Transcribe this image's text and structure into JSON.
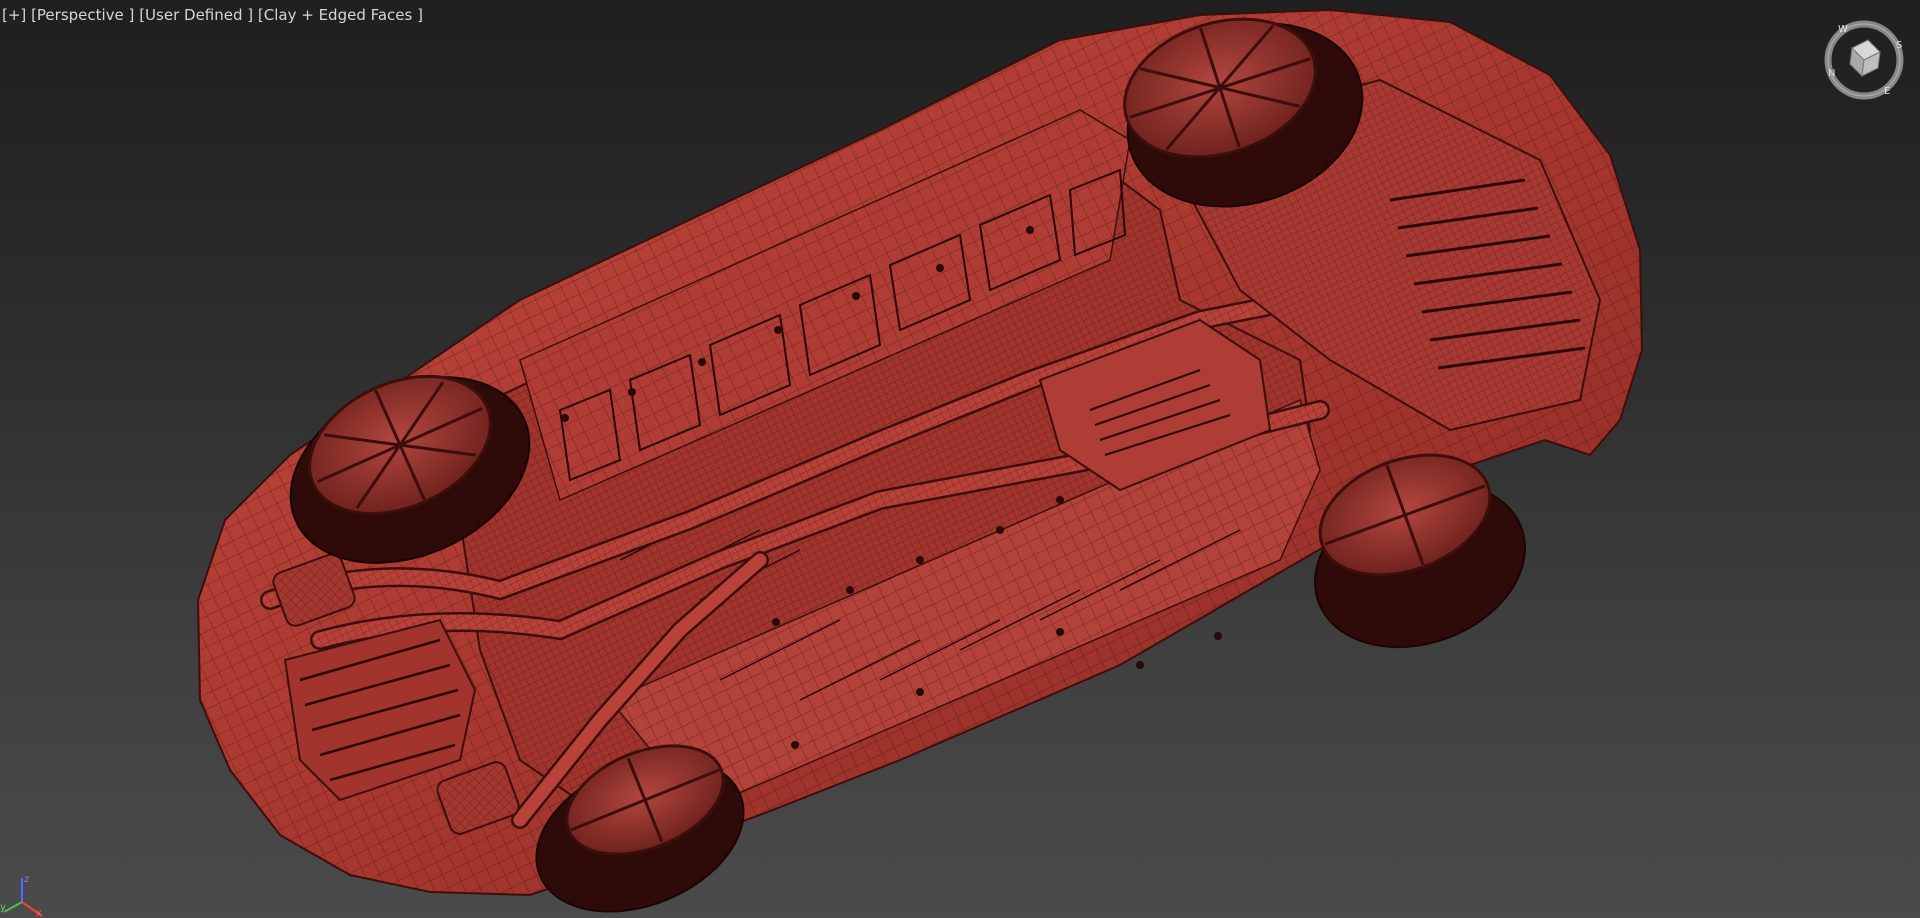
{
  "viewport": {
    "label_parts": [
      "[+]",
      "[Perspective ]",
      "[User Defined ]",
      "[Clay + Edged Faces ]"
    ]
  },
  "viewcube": {
    "compass_letters": [
      "W",
      "S",
      "E",
      "N"
    ]
  },
  "axis_tripod": {
    "x_label": "x",
    "y_label": "y",
    "z_label": "z"
  },
  "colors": {
    "clay": "#b9423b",
    "clay_dark": "#7d2623",
    "tire": "#2e0b09",
    "edge": "#3c0f0d",
    "background_top": "#1f1f1f",
    "background_bottom": "#4b4b4b"
  }
}
